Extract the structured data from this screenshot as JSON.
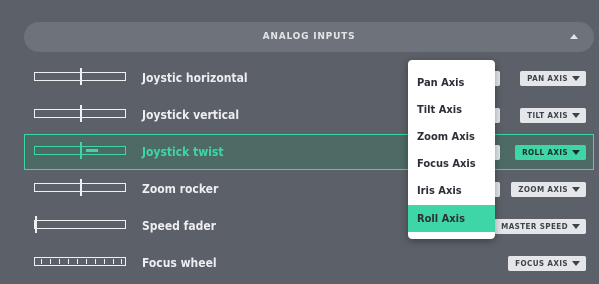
{
  "section": {
    "title": "ANALOG INPUTS"
  },
  "rows": [
    {
      "label": "Joystic horizontal",
      "assignment": "PAN AXIS"
    },
    {
      "label": "Joystick vertical",
      "assignment": "TILT AXIS"
    },
    {
      "label": "Joystick twist",
      "assignment": "ROLL AXIS"
    },
    {
      "label": "Zoom rocker",
      "assignment": "ZOOM AXIS"
    },
    {
      "label": "Speed fader",
      "assignment": "MASTER SPEED"
    },
    {
      "label": "Focus wheel",
      "assignment": "FOCUS AXIS"
    }
  ],
  "dropdown": {
    "options": [
      "Pan Axis",
      "Tilt Axis",
      "Zoom Axis",
      "Focus Axis",
      "Iris Axis",
      "Roll Axis"
    ],
    "selected": "Roll Axis"
  },
  "colors": {
    "accent": "#3fd6a7",
    "background": "#5c6068",
    "header": "#6e737b"
  }
}
